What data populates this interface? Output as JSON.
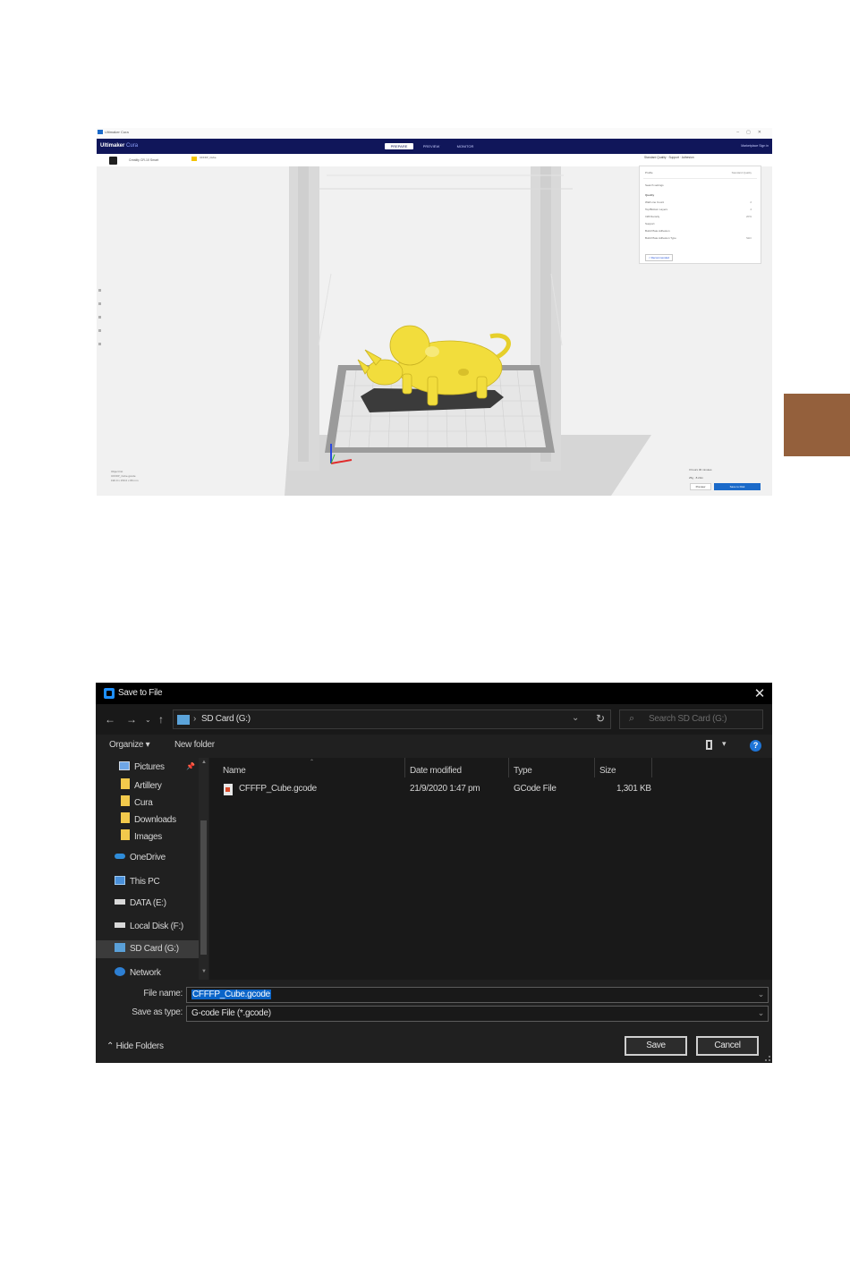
{
  "cura": {
    "app_title": "Ultimaker Cura",
    "brand": "Ultimaker",
    "brand_suffix": "Cura",
    "tabs": [
      "PREPARE",
      "PREVIEW",
      "MONITOR"
    ],
    "header_right": "Marketplace   Sign in",
    "printer": "Creality CR-10 Smart",
    "file_name": "CFFFP_Cube",
    "print_summary": "Standard Quality · Support · Adhesion",
    "settings_rows": [
      {
        "label": "Profile",
        "value": "Standard Quality"
      },
      {
        "label": "Search settings",
        "value": ""
      },
      {
        "label": "Quality",
        "value": ""
      },
      {
        "label": "Wall Line Count",
        "value": "2"
      },
      {
        "label": "Top/Bottom Layers",
        "value": "4"
      },
      {
        "label": "Infill Density",
        "value": "20%"
      },
      {
        "label": "Support",
        "value": ""
      },
      {
        "label": "Build Plate Adhesion",
        "value": ""
      },
      {
        "label": "Build Plate Adhesion Type",
        "value": "Skirt"
      }
    ],
    "settings_button": "< Recommended",
    "object_list": [
      "Object list",
      "CFFFP_Cube.gcode",
      "190.0 x 150.0 x 80 mm"
    ],
    "bottom_info": [
      "3 hours 30 minutes",
      "25g · 8.24m"
    ],
    "preview_button": "Preview",
    "save_button": "Save to Disk",
    "colors": {
      "header": "#10165a",
      "model": "#f2dd3c",
      "accent": "#1b6ac9"
    }
  },
  "dialog": {
    "title": "Save to File",
    "location": "SD Card (G:)",
    "search_placeholder": "Search SD Card (G:)",
    "organize": "Organize ▾",
    "new_folder": "New folder",
    "nav_items": [
      {
        "label": "Pictures",
        "icon": "pictures-icon"
      },
      {
        "label": "Artillery",
        "icon": "folder-icon"
      },
      {
        "label": "Cura",
        "icon": "folder-icon"
      },
      {
        "label": "Downloads",
        "icon": "folder-icon"
      },
      {
        "label": "Images",
        "icon": "folder-icon"
      },
      {
        "label": "OneDrive",
        "icon": "cloud-icon"
      },
      {
        "label": "This PC",
        "icon": "pc-icon"
      },
      {
        "label": "DATA (E:)",
        "icon": "drive-icon"
      },
      {
        "label": "Local Disk (F:)",
        "icon": "drive-icon"
      },
      {
        "label": "SD Card (G:)",
        "icon": "sd-card-icon"
      },
      {
        "label": "Network",
        "icon": "network-icon"
      }
    ],
    "columns": {
      "name": "Name",
      "date": "Date modified",
      "type": "Type",
      "size": "Size"
    },
    "files": [
      {
        "name": "CFFFP_Cube.gcode",
        "date": "21/9/2020 1:47 pm",
        "type": "GCode File",
        "size": "1,301 KB"
      }
    ],
    "file_name_label": "File name:",
    "file_name_value": "CFFFP_Cube.gcode",
    "save_type_label": "Save as type:",
    "save_type_value": "G-code File (*.gcode)",
    "hide_folders": "Hide Folders",
    "save_button": "Save",
    "cancel_button": "Cancel"
  }
}
